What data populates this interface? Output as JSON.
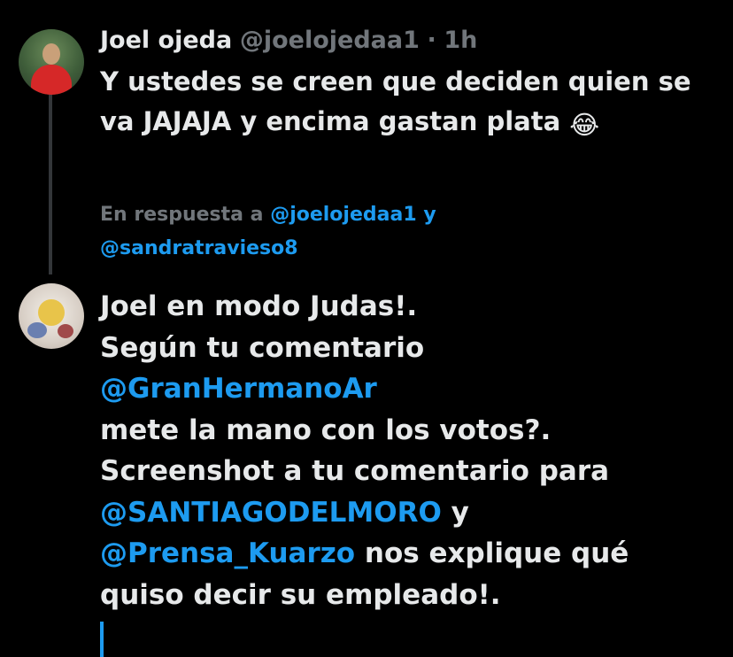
{
  "original_tweet": {
    "display_name": "Joel ojeda",
    "handle": "@joelojedaa1",
    "separator": "·",
    "time": "1h",
    "text": "Y ustedes se creen que deciden quien se va JAJAJA y encima gastan plata",
    "emoji": "😂"
  },
  "reply": {
    "replying_prefix": "En respuesta a",
    "replying_to_1": "@joelojedaa1",
    "replying_joiner": "y",
    "replying_to_2": "@sandratravieso8",
    "lines": {
      "l1": "Joel en modo Judas!.",
      "l2": "Según tu comentario",
      "m1": "@GranHermanoAr",
      "l3": "mete la mano con los votos?.",
      "l4": "Screenshot a tu comentario para",
      "m2": "@SANTIAGODELMORO",
      "l5": " y",
      "m3": "@Prensa_Kuarzo",
      "l6": " nos explique qué",
      "l7": "quiso decir su empleado!."
    }
  },
  "colors": {
    "background": "#000000",
    "text": "#e7e9ea",
    "secondary": "#71767b",
    "link": "#1d9bf0",
    "thread_line": "#333639"
  },
  "icons": {
    "original_avatar": "user-avatar-photo",
    "reply_avatar": "user-avatar-illustration"
  }
}
